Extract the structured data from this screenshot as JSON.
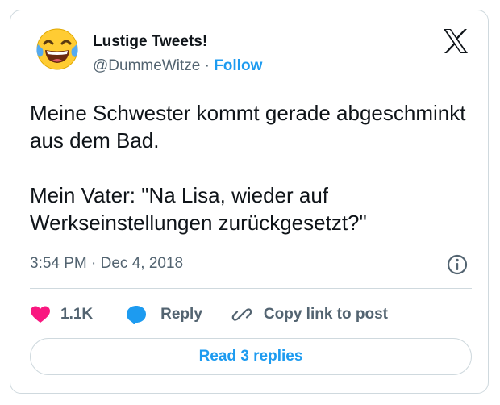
{
  "author": {
    "display_name": "Lustige Tweets!",
    "handle": "@DummeWitze",
    "separator": "·",
    "follow_label": "Follow",
    "avatar_icon": "face-with-tears-of-joy-emoji"
  },
  "tweet": {
    "paragraph_1": "Meine Schwester kommt gerade abgeschminkt aus dem Bad.",
    "paragraph_2": "Mein Vater: \"Na Lisa, wieder auf Werkseinstellungen zurückgesetzt?\"",
    "timestamp": "3:54 PM · Dec 4, 2018"
  },
  "actions": {
    "like_count": "1.1K",
    "reply_label": "Reply",
    "copy_link_label": "Copy link to post"
  },
  "footer": {
    "read_replies_label": "Read 3 replies"
  },
  "colors": {
    "accent": "#1d9bf0",
    "like": "#f91880",
    "text": "#0f1419",
    "secondary_text": "#536471",
    "border": "#cfd9de"
  }
}
